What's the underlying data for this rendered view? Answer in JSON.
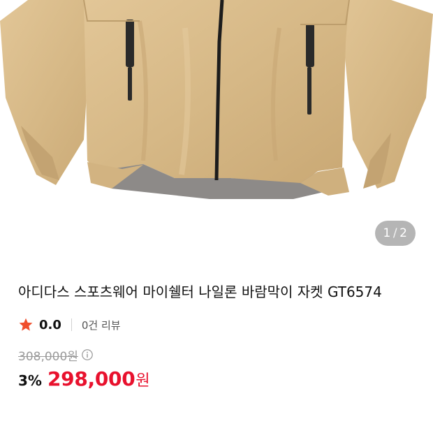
{
  "product": {
    "image_alt": "jacket-photo",
    "image_index": "1",
    "image_separator": "/",
    "image_total": "2",
    "title": "아디다스 스포츠웨어 마이쉘터 나일론 바람막이 자켓 GT6574",
    "rating": "0.0",
    "review_count": "0건 리뷰",
    "original_price": "308,000원",
    "discount": "3%",
    "sale_price": "298,000",
    "currency": "원"
  },
  "colors": {
    "star": "#f04e2c",
    "sale_price": "#e8112d",
    "jacket": "#d8bb8c"
  }
}
